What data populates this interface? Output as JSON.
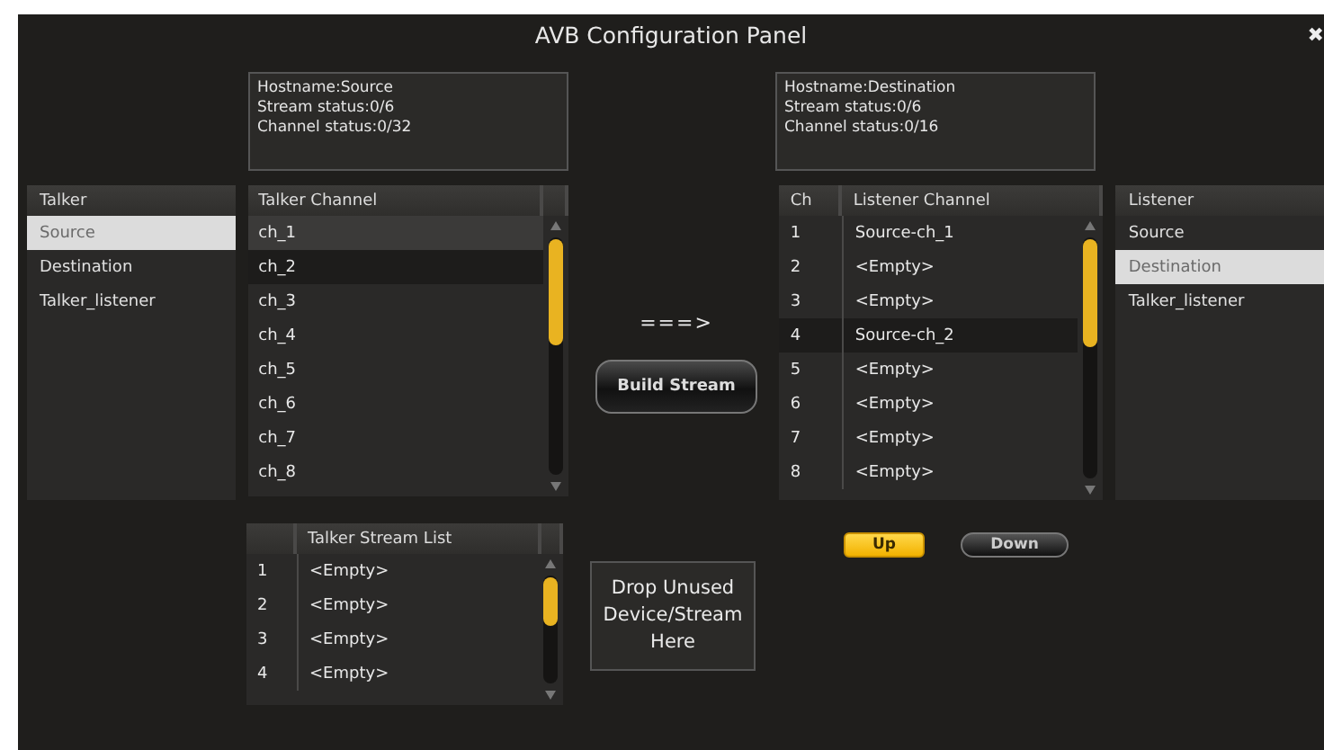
{
  "window": {
    "title": "AVB Configuration Panel",
    "close": "✖"
  },
  "talker_info": [
    "Hostname:Source",
    "Stream status:0/6",
    "Channel status:0/32"
  ],
  "listener_info": [
    "Hostname:Destination",
    "Stream status:0/6",
    "Channel status:0/16"
  ],
  "talker_list": {
    "header": "Talker",
    "items": [
      {
        "label": "Source",
        "selected": true
      },
      {
        "label": "Destination",
        "selected": false
      },
      {
        "label": "Talker_listener",
        "selected": false
      }
    ]
  },
  "talker_channel": {
    "header": "Talker Channel",
    "rows": [
      {
        "label": "ch_1",
        "selected": true,
        "highlighted": false
      },
      {
        "label": "ch_2",
        "selected": false,
        "highlighted": true
      },
      {
        "label": "ch_3",
        "selected": false,
        "highlighted": false
      },
      {
        "label": "ch_4",
        "selected": false,
        "highlighted": false
      },
      {
        "label": "ch_5",
        "selected": false,
        "highlighted": false
      },
      {
        "label": "ch_6",
        "selected": false,
        "highlighted": false
      },
      {
        "label": "ch_7",
        "selected": false,
        "highlighted": false
      },
      {
        "label": "ch_8",
        "selected": false,
        "highlighted": false
      }
    ]
  },
  "arrow": "===>",
  "build_button": "Build Stream",
  "listener_channel": {
    "columns": [
      "Ch",
      "Listener Channel"
    ],
    "rows": [
      {
        "ch": "1",
        "label": "Source-ch_1",
        "highlighted": false
      },
      {
        "ch": "2",
        "label": "<Empty>",
        "highlighted": false
      },
      {
        "ch": "3",
        "label": "<Empty>",
        "highlighted": false
      },
      {
        "ch": "4",
        "label": "Source-ch_2",
        "highlighted": true
      },
      {
        "ch": "5",
        "label": "<Empty>",
        "highlighted": false
      },
      {
        "ch": "6",
        "label": "<Empty>",
        "highlighted": false
      },
      {
        "ch": "7",
        "label": "<Empty>",
        "highlighted": false
      },
      {
        "ch": "8",
        "label": "<Empty>",
        "highlighted": false
      }
    ]
  },
  "listener_list": {
    "header": "Listener",
    "items": [
      {
        "label": "Source",
        "selected": false
      },
      {
        "label": "Destination",
        "selected": true
      },
      {
        "label": "Talker_listener",
        "selected": false
      }
    ]
  },
  "move_buttons": [
    {
      "label": "Up",
      "selected": true
    },
    {
      "label": "Down",
      "selected": false
    }
  ],
  "talker_stream_list": {
    "header": "Talker Stream List",
    "rows": [
      {
        "num": "1",
        "label": "<Empty>"
      },
      {
        "num": "2",
        "label": "<Empty>"
      },
      {
        "num": "3",
        "label": "<Empty>"
      },
      {
        "num": "4",
        "label": "<Empty>"
      }
    ]
  },
  "drop_zone": "Drop Unused Device/Stream Here"
}
